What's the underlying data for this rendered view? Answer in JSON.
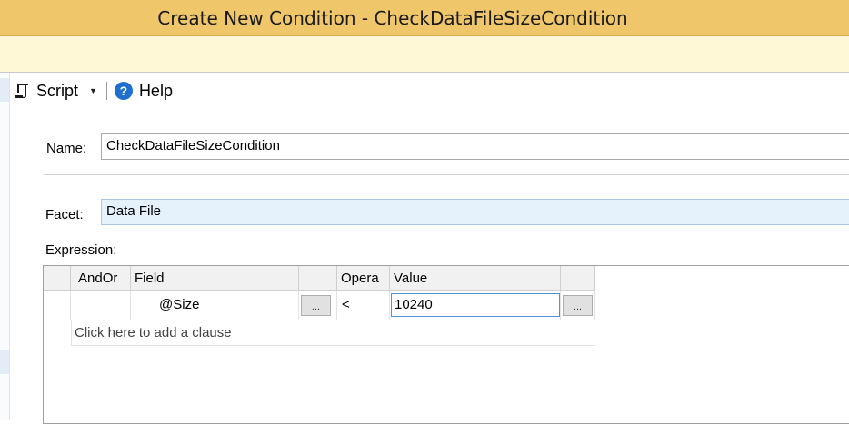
{
  "window": {
    "title": "Create New Condition - CheckDataFileSizeCondition"
  },
  "toolbar": {
    "script_label": "Script",
    "help_label": "Help"
  },
  "form": {
    "name_label": "Name:",
    "name_value": "CheckDataFileSizeCondition",
    "facet_label": "Facet:",
    "facet_value": "Data File",
    "expression_label": "Expression:"
  },
  "expression_grid": {
    "columns": [
      "AndOr",
      "Field",
      "",
      "Opera",
      "Value",
      ""
    ],
    "rows": [
      {
        "andor": "",
        "field": "@Size",
        "field_button": "...",
        "operator": "<",
        "value": "10240",
        "value_button": "..."
      }
    ],
    "add_clause_text": "Click here to add a clause"
  }
}
